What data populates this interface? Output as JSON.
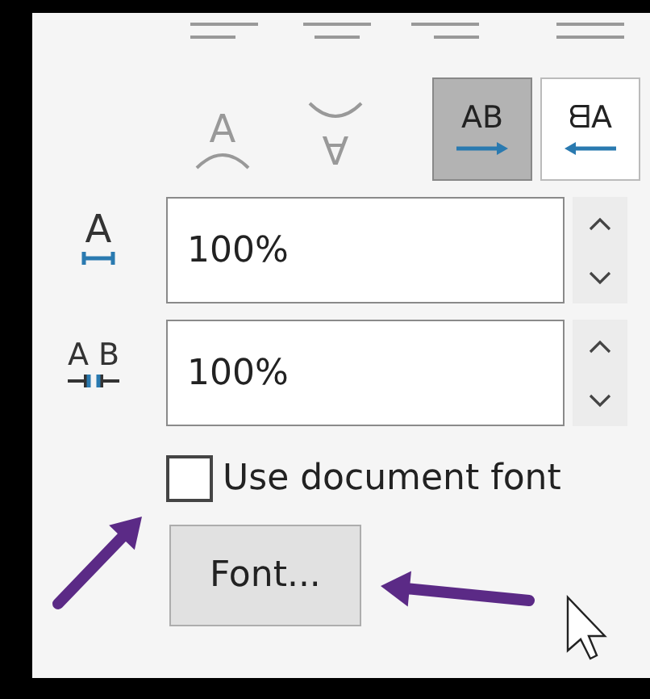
{
  "alignment_icons": [
    {
      "kind": "left"
    },
    {
      "kind": "center"
    },
    {
      "kind": "right"
    },
    {
      "kind": "justify"
    }
  ],
  "text_effects": [
    {
      "kind": "arc-up",
      "glyph": "A"
    },
    {
      "kind": "arc-down",
      "glyph": "∀"
    }
  ],
  "direction_buttons": [
    {
      "glyph": "AB",
      "kind": "ltr",
      "selected": true
    },
    {
      "glyph": "ᗺA",
      "kind": "rtl",
      "selected": false
    }
  ],
  "spin_fields": [
    {
      "kind": "width",
      "glyph": "A",
      "value": "100%"
    },
    {
      "kind": "spacing",
      "glyph": "A B",
      "value": "100%"
    }
  ],
  "use_document_font": {
    "label": "Use document font",
    "checked": false
  },
  "font_button": {
    "label": "Font..."
  },
  "annotations": [
    {
      "kind": "arrow",
      "color": "#5b2a86"
    },
    {
      "kind": "arrow",
      "color": "#5b2a86"
    }
  ]
}
